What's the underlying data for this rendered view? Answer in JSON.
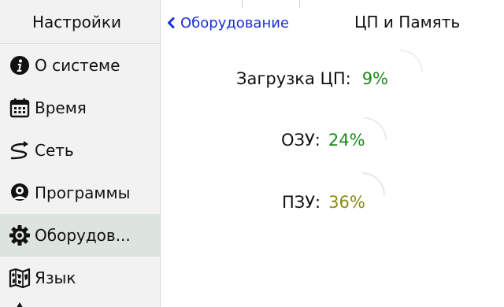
{
  "sidebar": {
    "title": "Настройки",
    "items": [
      {
        "label": "О системе",
        "icon": "info-icon",
        "active": false
      },
      {
        "label": "Время",
        "icon": "calendar-icon",
        "active": false
      },
      {
        "label": "Сеть",
        "icon": "network-icon",
        "active": false
      },
      {
        "label": "Программы",
        "icon": "apps-icon",
        "active": false
      },
      {
        "label": "Оборудов...",
        "icon": "gear-icon",
        "active": true
      },
      {
        "label": "Язык",
        "icon": "map-icon",
        "active": false
      }
    ]
  },
  "topbar": {
    "back_label": "Оборудование",
    "title": "ЦП и Память"
  },
  "stats": {
    "cpu": {
      "label": "Загрузка ЦП:",
      "value": "9%",
      "percent": 9,
      "color": "#1a8a1a"
    },
    "ram": {
      "label": "ОЗУ:",
      "value": "24%",
      "percent": 24,
      "color": "#1a8a1a"
    },
    "rom": {
      "label": "ПЗУ:",
      "value": "36%",
      "percent": 36,
      "color": "#8a8a14"
    }
  },
  "colors": {
    "accent": "#1a2fd6",
    "sidebar_bg": "#f2f2f2",
    "active_bg": "#dde3dd"
  }
}
